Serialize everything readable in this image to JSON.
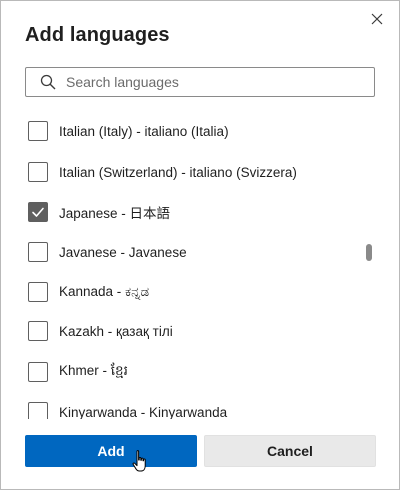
{
  "dialog": {
    "title": "Add languages",
    "close_icon": "close-icon"
  },
  "search": {
    "placeholder": "Search languages",
    "value": "",
    "icon": "search-icon"
  },
  "languages": [
    {
      "label": "Italian (Italy) - italiano (Italia)",
      "checked": false
    },
    {
      "label": "Italian (Switzerland) - italiano (Svizzera)",
      "checked": false
    },
    {
      "label": "Japanese - 日本語",
      "checked": true
    },
    {
      "label": "Javanese - Javanese",
      "checked": false
    },
    {
      "label": "Kannada - ಕನ್ನಡ",
      "checked": false
    },
    {
      "label": "Kazakh - қазақ тілі",
      "checked": false
    },
    {
      "label": "Khmer - ខ្មែរ",
      "checked": false
    },
    {
      "label": "Kinyarwanda - Kinyarwanda",
      "checked": false
    }
  ],
  "buttons": {
    "add": "Add",
    "cancel": "Cancel"
  },
  "colors": {
    "accent": "#0067c0",
    "checkbox_checked": "#5f5f5f",
    "cancel_bg": "#e9e9e9"
  },
  "cursor": "hand-pointer-icon"
}
